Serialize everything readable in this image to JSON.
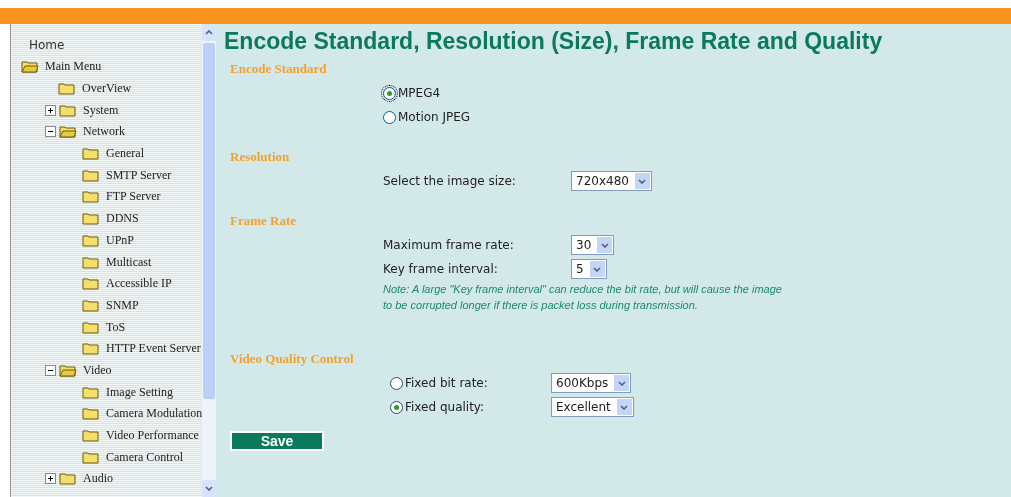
{
  "sidebar": {
    "home": "Home",
    "tree": [
      {
        "label": "Main Menu",
        "expanded": true,
        "children": [
          {
            "label": "OverView"
          },
          {
            "label": "System",
            "expanded": false
          },
          {
            "label": "Network",
            "expanded": true,
            "children": [
              {
                "label": "General"
              },
              {
                "label": "SMTP Server"
              },
              {
                "label": "FTP Server"
              },
              {
                "label": "DDNS"
              },
              {
                "label": "UPnP"
              },
              {
                "label": "Multicast"
              },
              {
                "label": "Accessible IP"
              },
              {
                "label": "SNMP"
              },
              {
                "label": "ToS"
              },
              {
                "label": "HTTP Event Server"
              }
            ]
          },
          {
            "label": "Video",
            "expanded": true,
            "children": [
              {
                "label": "Image Setting"
              },
              {
                "label": "Camera Modulation"
              },
              {
                "label": "Video Performance"
              },
              {
                "label": "Camera Control"
              }
            ]
          },
          {
            "label": "Audio",
            "expanded": false
          }
        ]
      }
    ]
  },
  "page": {
    "title": "Encode Standard, Resolution (Size), Frame Rate and Quality",
    "sections": [
      {
        "heading": "Encode Standard",
        "fields": [
          {
            "kind": "radio",
            "label": "MPEG4",
            "selected": true,
            "focused": true
          },
          {
            "kind": "radio",
            "label": "Motion JPEG",
            "selected": false,
            "focused": false
          }
        ]
      },
      {
        "heading": "Resolution",
        "fields": [
          {
            "kind": "select",
            "label": "Select the image size:",
            "value": "720x480"
          }
        ]
      },
      {
        "heading": "Frame Rate",
        "fields": [
          {
            "kind": "select",
            "label": "Maximum frame rate:",
            "value": "30"
          },
          {
            "kind": "select",
            "label": "Key frame interval:",
            "value": "5"
          },
          {
            "kind": "note",
            "text": "Note: A large \"Key frame interval\" can reduce the bit rate, but will cause the image to be corrupted longer if there is packet loss during transmission."
          }
        ]
      },
      {
        "heading": "Video Quality Control",
        "fields": [
          {
            "kind": "radio_select",
            "label": "Fixed bit rate:",
            "selected": false,
            "value": "600Kbps"
          },
          {
            "kind": "radio_select",
            "label": "Fixed quality:",
            "selected": true,
            "value": "Excellent"
          }
        ]
      }
    ],
    "save_button": "Save"
  }
}
